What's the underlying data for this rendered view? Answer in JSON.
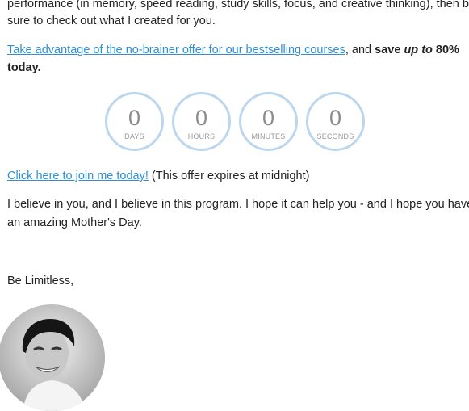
{
  "intro": {
    "line1": "performance (in memory, speed reading, study skills, focus, and creative thinking), then be",
    "line2": "sure to check out what I created for you."
  },
  "offer": {
    "link_text": "Take advantage of the no-brainer offer for our bestselling courses",
    "mid_text": ", and ",
    "bold_save": "save ",
    "italic_up_to": "up to",
    "bold_pct": " 80%",
    "bold_today": "today."
  },
  "countdown": [
    {
      "value": "0",
      "unit": "DAYS"
    },
    {
      "value": "0",
      "unit": "HOURS"
    },
    {
      "value": "0",
      "unit": "MINUTES"
    },
    {
      "value": "0",
      "unit": "SECONDS"
    }
  ],
  "join": {
    "link_text": "Click here to join me today!",
    "note": " (This offer expires at midnight)"
  },
  "belief": {
    "line1": "I believe in you, and I believe in this program. I hope it can help you - and I hope you have",
    "line2": "an amazing Mother's Day."
  },
  "signoff": "Be Limitless,",
  "colors": {
    "link": "#2f8fd3",
    "ring": "#bcd6ee",
    "text": "#222222"
  }
}
